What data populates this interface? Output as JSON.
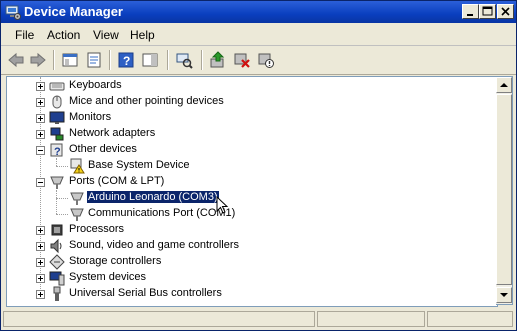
{
  "window": {
    "title": "Device Manager",
    "title_icon": "device-manager-icon",
    "controls": [
      "minimize-icon",
      "maximize-icon",
      "close-icon"
    ]
  },
  "menu": {
    "items": [
      "File",
      "Action",
      "View",
      "Help"
    ]
  },
  "toolbar": {
    "buttons": [
      "back-icon",
      "forward-icon",
      "console-tree-icon",
      "properties-icon",
      "help-icon",
      "action-pane-icon",
      "scan-hardware-icon",
      "update-driver-icon",
      "uninstall-icon",
      "disable-icon"
    ]
  },
  "tree": {
    "categories": [
      {
        "label": "Keyboards",
        "icon": "keyboard-icon",
        "expanded": false
      },
      {
        "label": "Mice and other pointing devices",
        "icon": "mouse-icon",
        "expanded": false
      },
      {
        "label": "Monitors",
        "icon": "monitor-icon",
        "expanded": false
      },
      {
        "label": "Network adapters",
        "icon": "network-adapter-icon",
        "expanded": false
      },
      {
        "label": "Other devices",
        "icon": "unknown-device-icon",
        "expanded": true,
        "children": [
          {
            "label": "Base System Device",
            "icon": "warning-device-icon"
          }
        ]
      },
      {
        "label": "Ports (COM & LPT)",
        "icon": "port-icon",
        "expanded": true,
        "children": [
          {
            "label": "Arduino Leonardo (COM3)",
            "icon": "port-icon",
            "selected": true
          },
          {
            "label": "Communications Port (COM1)",
            "icon": "port-icon"
          }
        ]
      },
      {
        "label": "Processors",
        "icon": "processor-icon",
        "expanded": false
      },
      {
        "label": "Sound, video and game controllers",
        "icon": "speaker-icon",
        "expanded": false
      },
      {
        "label": "Storage controllers",
        "icon": "storage-icon",
        "expanded": false
      },
      {
        "label": "System devices",
        "icon": "computer-icon",
        "expanded": false
      },
      {
        "label": "Universal Serial Bus controllers",
        "icon": "usb-icon",
        "expanded": false
      }
    ]
  },
  "colors": {
    "selection": "#0a246a",
    "title_bar": "#0a3fbf"
  }
}
